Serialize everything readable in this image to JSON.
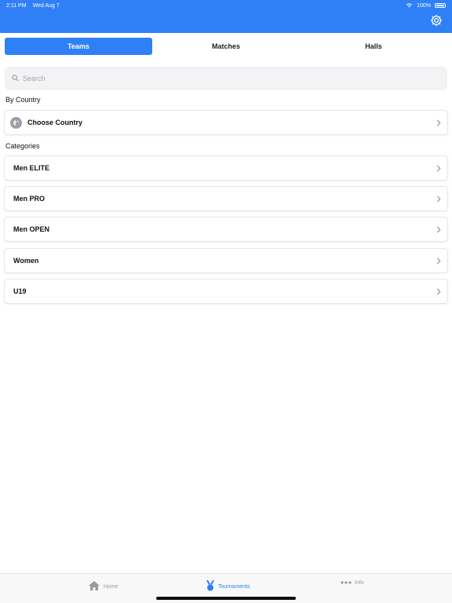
{
  "status_bar": {
    "time": "2:11 PM",
    "date": "Wed Aug 7",
    "battery": "100%"
  },
  "colors": {
    "accent": "#2f80f7",
    "icon_gray": "#9ca0a6"
  },
  "segments": [
    {
      "label": "Teams",
      "active": true
    },
    {
      "label": "Matches",
      "active": false
    },
    {
      "label": "Halls",
      "active": false
    }
  ],
  "search": {
    "placeholder": "Search",
    "value": ""
  },
  "by_country": {
    "heading": "By Country",
    "item_label": "Choose Country",
    "icon": "globe-icon"
  },
  "categories": {
    "heading": "Categories",
    "items": [
      {
        "label": "Men ELITE"
      },
      {
        "label": "Men PRO"
      },
      {
        "label": "Men OPEN"
      },
      {
        "label": "Women"
      },
      {
        "label": "U19"
      }
    ]
  },
  "tabbar": {
    "home": "Home",
    "tournaments": "Tournaments",
    "info": "Info"
  }
}
